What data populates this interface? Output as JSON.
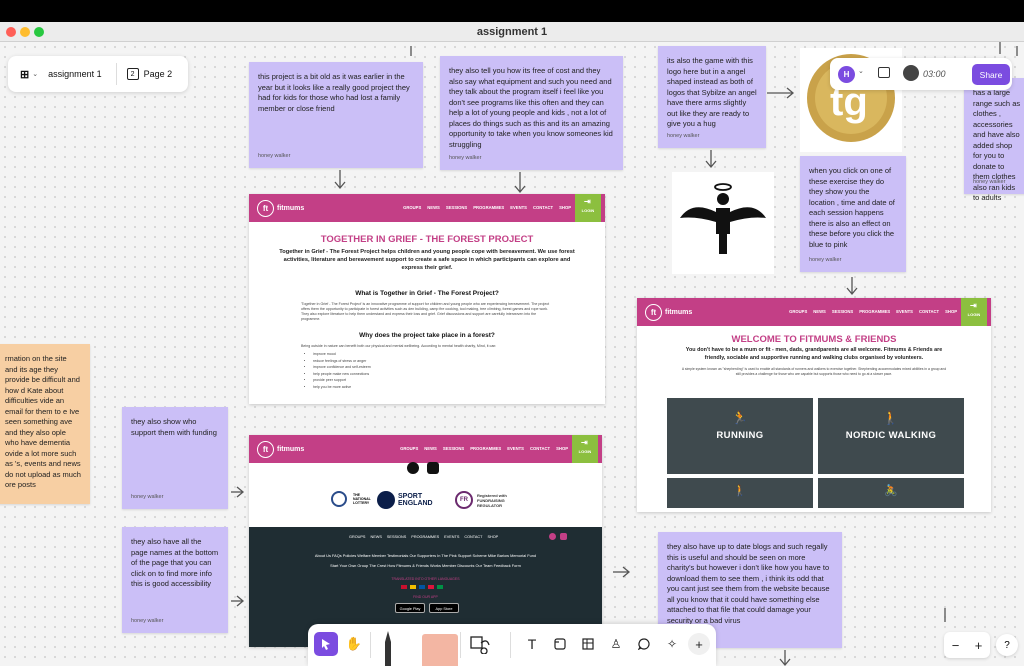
{
  "window": {
    "title": "assignment 1"
  },
  "top_left": {
    "file_name": "assignment 1",
    "page_count": "2",
    "page_label": "Page 2"
  },
  "top_right": {
    "avatar_letter": "H",
    "timer": "03:00",
    "share_label": "Share"
  },
  "stickies": [
    {
      "text": "this project is a bit old as it was earlier in the year but it looks like a really good project they had for kids for those who had lost a family member or close friend",
      "author": "honey walker"
    },
    {
      "text": "they also tell you how its free of cost and they also say what equipment and such you need and they talk about the program itself i feel like you don't see programs like this often and they can help a lot of young people and kids , not a lot of places do things such as this and its an amazing opportunity to take when you know someones kid struggling",
      "author": "honey walker"
    },
    {
      "text": "its also the game with this logo here but in a angel shaped  instead as both of logos that Sybilze an angel have there arms slightly out like they are ready to give you a hug",
      "author": "honey walker"
    },
    {
      "text": "when you click on one of these exercise they do they show you the location , time and date of each session happens there is also an effect on these before you click the blue to pink",
      "author": "honey walker"
    },
    {
      "text": "has a large range such as clothes , accessories and have also added shop for you to donate to them clothes also ran kids to adults",
      "author": "honey walker"
    },
    {
      "text": "they also show who support them with funding",
      "author": "honey walker"
    },
    {
      "text": "they also have all the page names at the bottom of the page that you can click on to find more info this is good accessibility",
      "author": "honey walker"
    },
    {
      "text": "they also have up to date blogs and such regally this is useful and should be seen on more charity's but however i don't like how you have to download them to see them , i think its odd that you cant just see them from the website because all you know that it could have something else attached to that file that could damage your security or a bad virus",
      "author": ""
    },
    {
      "text": "rmation on the site and its age they provide be difficult and how d Kate about difficulties vide an email for them to e Ive seen something ave and they also ople who have dementia ovide a lot more such as 's, events and news do not upload as much ore posts",
      "author": ""
    }
  ],
  "site": {
    "logo_mark": "ft",
    "logo_word": "fitmums",
    "nav": [
      "GROUPS",
      "NEWS",
      "SESSIONS",
      "PROGRAMMES",
      "EVENTS",
      "CONTACT",
      "SHOP"
    ],
    "login": "LOGIN"
  },
  "forest_page": {
    "title": "TOGETHER IN GRIEF - THE FOREST PROJECT",
    "lead": "Together in Grief - The Forest Project helps children and young people cope with bereavement. We use forest activities, literature and bereavement support to create a safe space in which participants can explore and express their grief.",
    "h2_what": "What is Together in Grief - The Forest Project?",
    "what_text": "'Together in Grief - The Forest Project' is an innovative programme of support for children and young people who are experiencing bereavement. The project offers them the opportunity to participate in forest activities such as den building, camp fire cooking, tool making, tree climbing, forest games and rope work. They also explore literature to help them understand and express their loss and grief. Grief discussions and support are carefully interwoven into the programme.",
    "h2_why": "Why does the project take place in a forest?",
    "why_text": "Being outside in nature can benefit both our physical and mental wellbeing. According to mental health charity, Mind, it can:",
    "bullets": [
      "improve mood",
      "reduce feelings of stress or anger",
      "improve confidence and self-esteem",
      "help people make new connections",
      "provide peer support",
      "help you be more active"
    ]
  },
  "footer_page": {
    "sponsor_lottery": "THE NATIONAL LOTTERY",
    "sponsor_sport": "SPORT ENGLAND",
    "sponsor_fr": "Registered with FUNDRAISING REGULATOR",
    "footer_links_row1": "About Us   FAQs   Policies   Welfare   Member Testimonials   Our Supporters   In The Pink Support Scheme   Mike Barlow Memorial Fund",
    "footer_links_row2": "Start Your Own Group   The Crest   How Fitmums & Friends Works   Member Discounts   Our Team   Feedback Form",
    "translate": "TRANSLATED INTO OTHER LANGUAGES",
    "app_label": "FIND OUR APP",
    "google_play": "Google Play",
    "app_store": "App Store"
  },
  "welcome_page": {
    "title": "WELCOME TO FITMUMS & FRIENDS",
    "lead": "You don't have to be a mum or fit - men, dads, grandparents are all welcome. Fitmums & Friends are friendly, sociable and supportive running and walking clubs organised by volunteers.",
    "text": "A simple system known as \"shepherding\" is used to enable all standards of runners and walkers to exercise together. Shepherding accommodates mixed abilities in a group and still provides a challenge for those who are capable but supports those who need to go at a slower pace.",
    "tiles": [
      "RUNNING",
      "NORDIC WALKING"
    ]
  },
  "colors": {
    "sticky": "#cbbff7",
    "sticky_peach": "#f7cfa3",
    "site_pink": "#c33f86",
    "site_green": "#8cbf3f",
    "share_purple": "#7b4ce0"
  }
}
